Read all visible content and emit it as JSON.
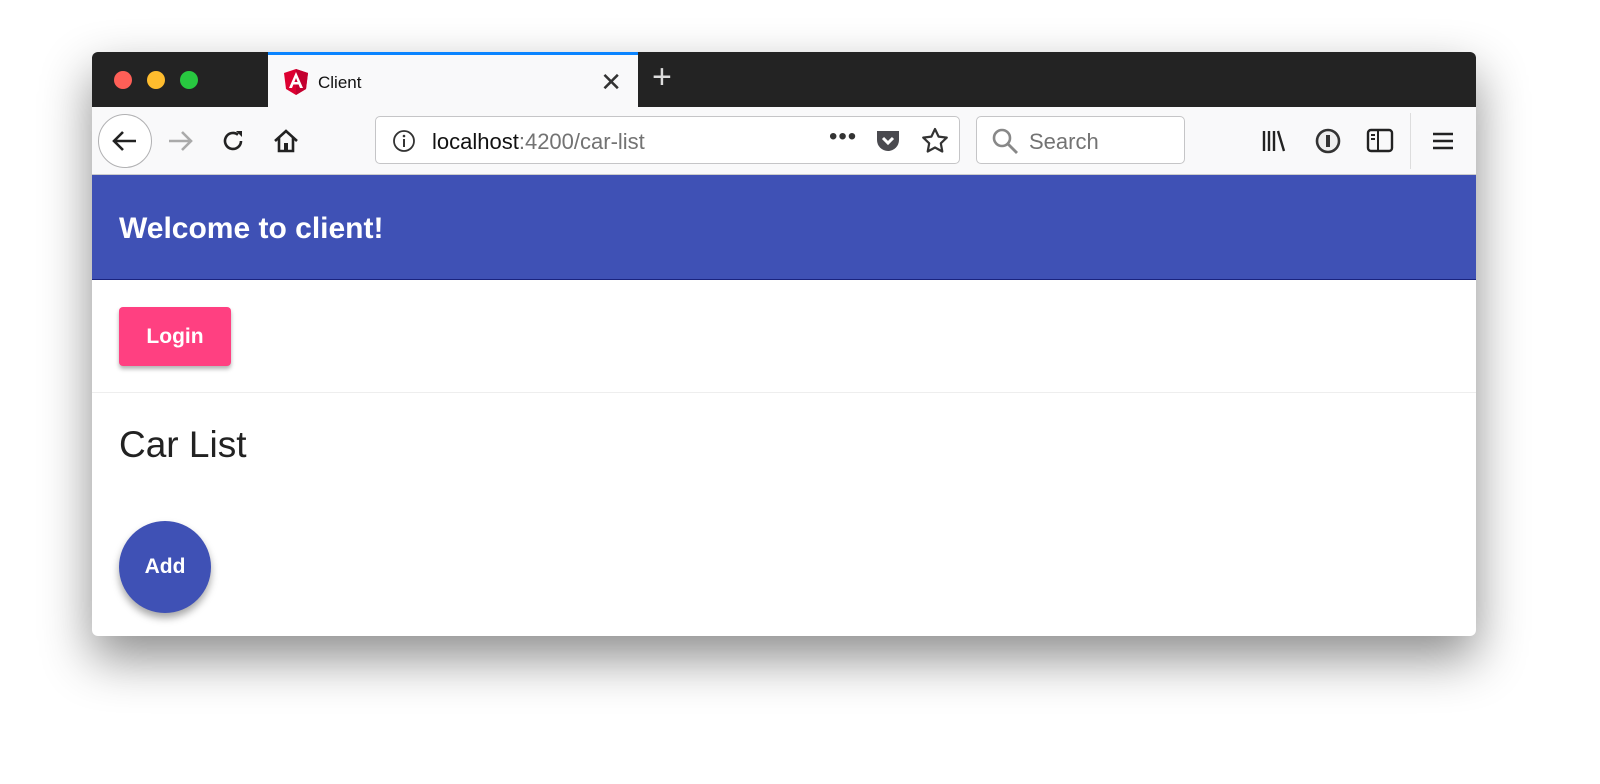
{
  "browser": {
    "tab_title": "Client",
    "url_host": "localhost",
    "url_path": ":4200/car-list",
    "search_placeholder": "Search",
    "icons": [
      "angular-icon",
      "close-icon",
      "plus-icon",
      "back-icon",
      "forward-icon",
      "reload-icon",
      "home-icon",
      "info-icon",
      "more-icon",
      "pocket-icon",
      "star-icon",
      "search-icon",
      "library-icon",
      "password-icon",
      "sidebar-icon",
      "menu-icon"
    ],
    "accent": "#0a84ff"
  },
  "app": {
    "header_title": "Welcome to client!",
    "login_label": "Login",
    "page_title": "Car List",
    "add_label": "Add",
    "colors": {
      "primary": "#3f51b5",
      "accent": "#ff4081"
    }
  }
}
